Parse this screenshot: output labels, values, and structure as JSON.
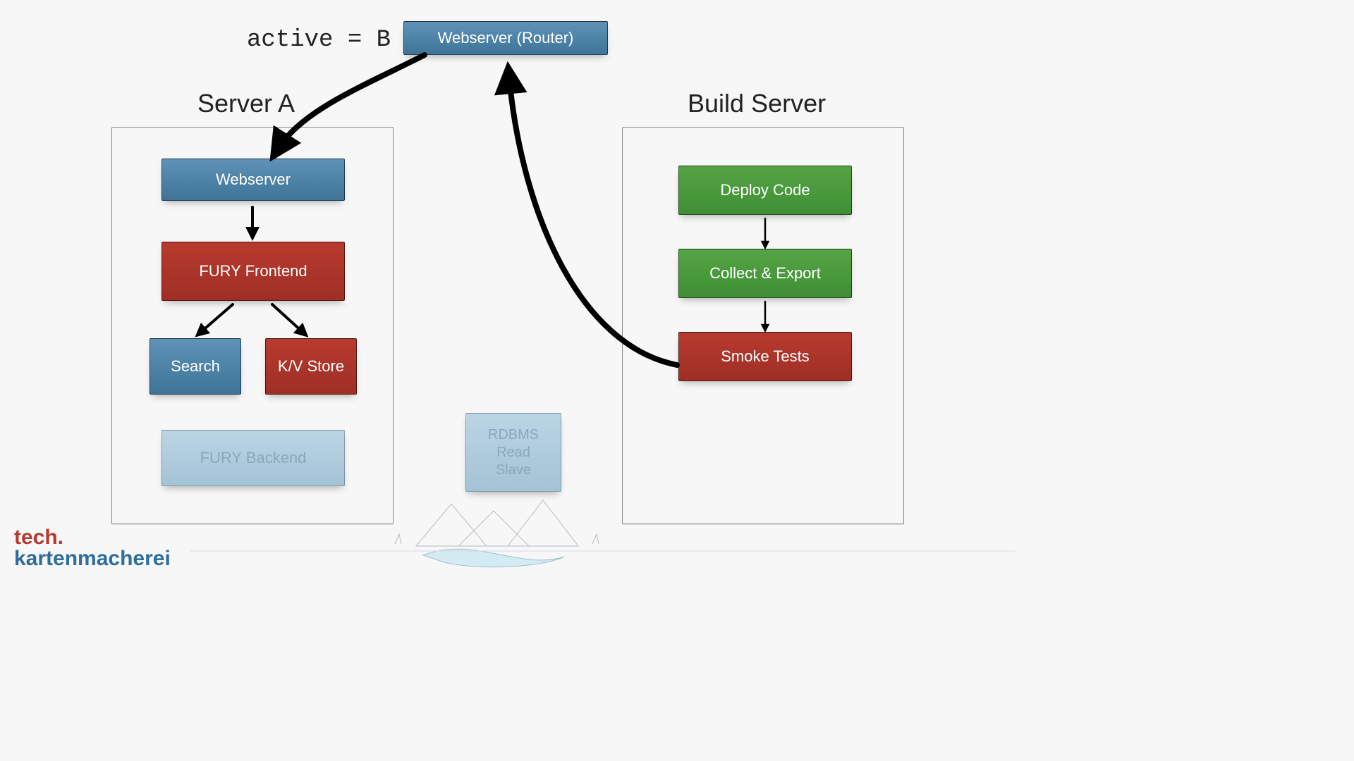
{
  "top": {
    "active_label": "active = B",
    "router_label": "Webserver (Router)"
  },
  "server_a": {
    "title": "Server A",
    "webserver": "Webserver",
    "frontend": "FURY Frontend",
    "search": "Search",
    "kv": "K/V Store",
    "backend": "FURY Backend"
  },
  "build_server": {
    "title": "Build Server",
    "deploy": "Deploy Code",
    "collect": "Collect & Export",
    "smoke": "Smoke Tests"
  },
  "rdbms": {
    "label": "RDBMS\nRead\nSlave"
  },
  "logo": {
    "line1": "tech.",
    "line2": "kartenmacherei"
  },
  "colors": {
    "blue_dark": "#3E7498",
    "blue_light": "#A3C3D6",
    "red": "#9E2F25",
    "green": "#3F8E34"
  }
}
